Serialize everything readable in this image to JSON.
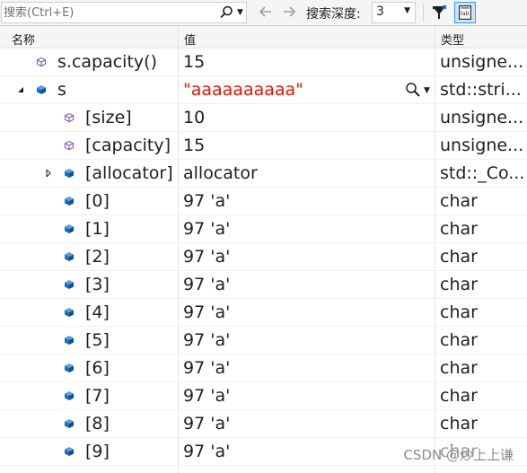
{
  "toolbar": {
    "search_placeholder": "搜索(Ctrl+E)",
    "depth_label": "搜索深度:",
    "depth_value": "3"
  },
  "columns": {
    "name": "名称",
    "value": "值",
    "type": "类型"
  },
  "rows": [
    {
      "name": "s.capacity()",
      "value": "15",
      "type": "unsigne...",
      "icon": "property-icon",
      "expander": ""
    },
    {
      "name": "s",
      "value": "\"aaaaaaaaaa\"",
      "type": "std::stri...",
      "icon": "field-icon",
      "expander": "expanded",
      "red": true,
      "visualizer": "magnifier-icon"
    },
    {
      "name": "[size]",
      "value": "10",
      "type": "unsigne...",
      "icon": "property-icon",
      "expander": ""
    },
    {
      "name": "[capacity]",
      "value": "15",
      "type": "unsigne...",
      "icon": "property-icon",
      "expander": ""
    },
    {
      "name": "[allocator]",
      "value": "allocator",
      "type": "std::_Co...",
      "icon": "field-icon",
      "expander": "collapsed"
    },
    {
      "name": "[0]",
      "value": "97 'a'",
      "type": "char",
      "icon": "field-icon",
      "expander": ""
    },
    {
      "name": "[1]",
      "value": "97 'a'",
      "type": "char",
      "icon": "field-icon",
      "expander": ""
    },
    {
      "name": "[2]",
      "value": "97 'a'",
      "type": "char",
      "icon": "field-icon",
      "expander": ""
    },
    {
      "name": "[3]",
      "value": "97 'a'",
      "type": "char",
      "icon": "field-icon",
      "expander": ""
    },
    {
      "name": "[4]",
      "value": "97 'a'",
      "type": "char",
      "icon": "field-icon",
      "expander": ""
    },
    {
      "name": "[5]",
      "value": "97 'a'",
      "type": "char",
      "icon": "field-icon",
      "expander": ""
    },
    {
      "name": "[6]",
      "value": "97 'a'",
      "type": "char",
      "icon": "field-icon",
      "expander": ""
    },
    {
      "name": "[7]",
      "value": "97 'a'",
      "type": "char",
      "icon": "field-icon",
      "expander": ""
    },
    {
      "name": "[8]",
      "value": "97 'a'",
      "type": "char",
      "icon": "field-icon",
      "expander": ""
    },
    {
      "name": "[9]",
      "value": "97 'a'",
      "type": "char",
      "icon": "field-icon",
      "expander": ""
    }
  ],
  "watermark": "CSDN @炒上上谦",
  "colors": {
    "string_value": "#e51400",
    "field_icon": "#1c6fb8",
    "property_icon": "#8a63c2",
    "selected_button_bg": "#cce4f7"
  }
}
